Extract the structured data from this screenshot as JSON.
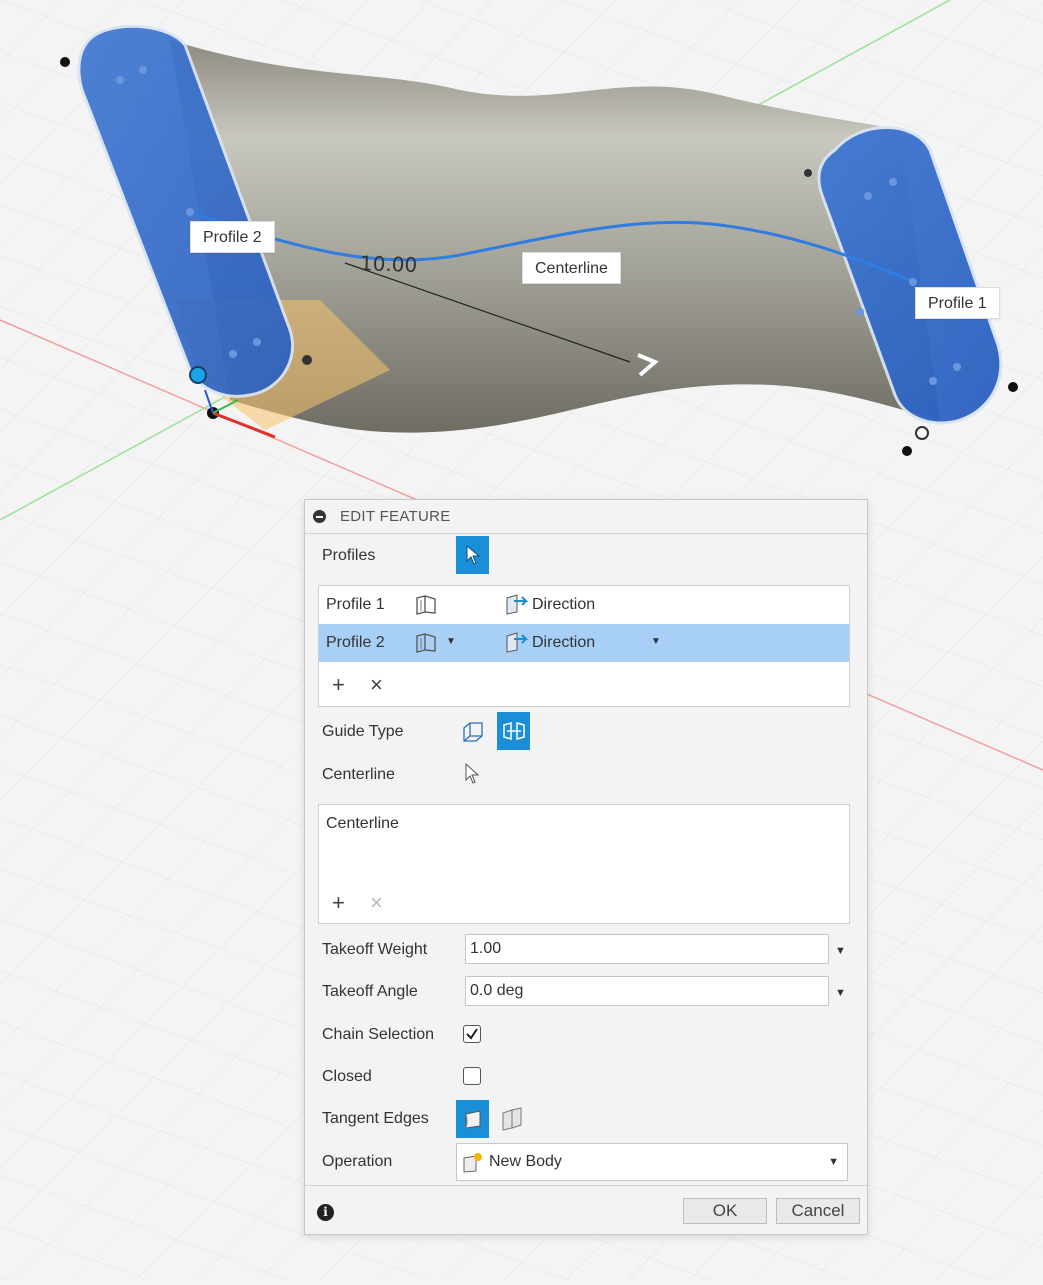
{
  "viewport": {
    "callouts": {
      "profile_2": "Profile 2",
      "centerline": "Centerline",
      "profile_1": "Profile 1"
    },
    "dimension": "10.00"
  },
  "dialog": {
    "title": "EDIT FEATURE",
    "profiles_label": "Profiles",
    "profiles_list": [
      {
        "name": "Profile 1",
        "direction": "Direction"
      },
      {
        "name": "Profile 2",
        "direction": "Direction"
      }
    ],
    "guide_type_label": "Guide Type",
    "centerline_label": "Centerline",
    "centerline_list": [
      "Centerline"
    ],
    "takeoff_weight_label": "Takeoff Weight",
    "takeoff_weight_value": "1.00",
    "takeoff_angle_label": "Takeoff Angle",
    "takeoff_angle_value": "0.0 deg",
    "chain_selection_label": "Chain Selection",
    "chain_selection_checked": true,
    "closed_label": "Closed",
    "closed_checked": false,
    "tangent_edges_label": "Tangent Edges",
    "operation_label": "Operation",
    "operation_value": "New Body",
    "ok_label": "OK",
    "cancel_label": "Cancel",
    "accent_color": "#1a8fd8",
    "selected_row_color": "#a8cff5"
  }
}
